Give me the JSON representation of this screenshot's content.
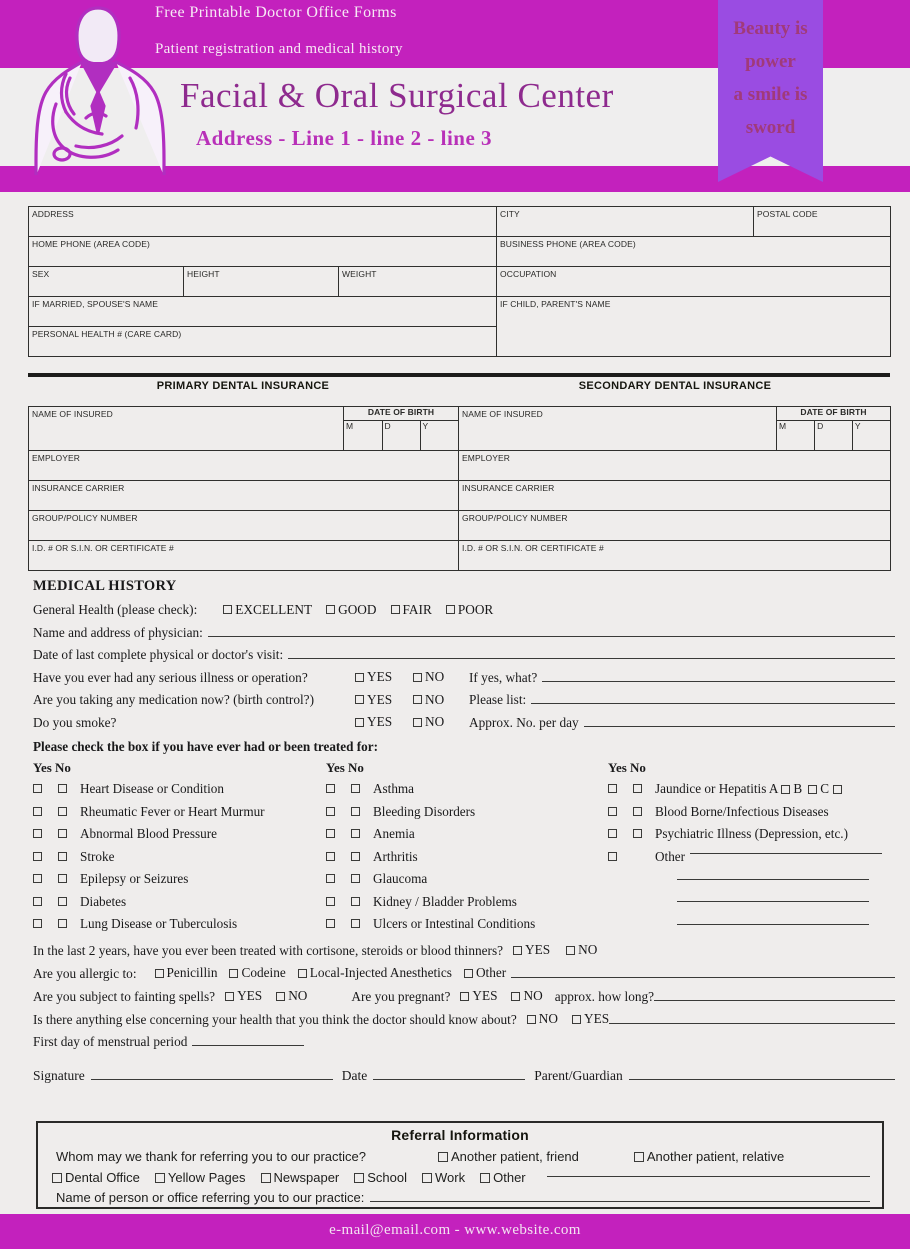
{
  "header": {
    "tagline1": "Free Printable Doctor Office Forms",
    "tagline2": "Patient registration and medical history",
    "clinic_name": "Facial & Oral Surgical Center",
    "address_line": "Address - Line 1 - line 2 - line 3",
    "ribbon_lines": [
      "Beauty is",
      "power",
      "a smile is",
      "sword"
    ],
    "colors": {
      "magenta": "#c321bd",
      "purple": "#9a4ce2",
      "clinic_text": "#8e2a8e",
      "ribbon_text": "#a03a7a"
    }
  },
  "personal": {
    "address": "ADDRESS",
    "city": "CITY",
    "postal_code": "POSTAL CODE",
    "home_phone": "HOME PHONE (AREA CODE)",
    "business_phone": "BUSINESS PHONE (AREA CODE)",
    "sex": "SEX",
    "height": "HEIGHT",
    "weight": "WEIGHT",
    "occupation": "OCCUPATION",
    "spouse": "IF MARRIED, SPOUSE'S NAME",
    "parent": "IF CHILD, PARENT'S NAME",
    "health_number": "PERSONAL HEALTH # (CARE CARD)"
  },
  "insurance": {
    "primary_title": "PRIMARY DENTAL INSURANCE",
    "secondary_title": "SECONDARY DENTAL INSURANCE",
    "name_of_insured": "NAME OF INSURED",
    "date_of_birth": "DATE  OF BIRTH",
    "date_of_birth_2": "DATE OF BIRTH",
    "m": "M",
    "d": "D",
    "y": "Y",
    "employer": "EMPLOYER",
    "carrier": "INSURANCE CARRIER",
    "group_policy": "GROUP/POLICY NUMBER",
    "id_cert": "I.D. # OR S.I.N. OR CERTIFICATE #"
  },
  "medical_history": {
    "title": "MEDICAL HISTORY",
    "general_health_label": "General Health (please check):",
    "general_health_options": [
      "EXCELLENT",
      "GOOD",
      "FAIR",
      "POOR"
    ],
    "physician_label": "Name and address of physician:",
    "last_visit_label": "Date of last complete physical or doctor's visit:",
    "yes": "YES",
    "no": "NO",
    "questions": [
      {
        "q": "Have you ever had any serious illness or operation?",
        "tail": "If yes, what?"
      },
      {
        "q": "Are you taking any medication now? (birth control?)",
        "tail": "Please list:"
      },
      {
        "q": "Do you smoke?",
        "tail": "Approx. No. per day"
      }
    ],
    "check_instruction": "Please check the box if you have ever had or been treated for:",
    "col_head_yes": "Yes",
    "col_head_no": "No",
    "conditions_col1": [
      "Heart Disease or Condition",
      "Rheumatic Fever or Heart Murmur",
      "Abnormal Blood Pressure",
      "Stroke",
      "Epilepsy or Seizures",
      "Diabetes",
      "Lung Disease or Tuberculosis"
    ],
    "conditions_col2": [
      "Asthma",
      "Bleeding Disorders",
      "Anemia",
      "Arthritis",
      "Glaucoma",
      "Kidney / Bladder Problems",
      "Ulcers or Intestinal Conditions"
    ],
    "conditions_col3": [
      "Jaundice or Hepatitis A",
      "Blood Borne/Infectious Diseases",
      "Psychiatric Illness (Depression, etc.)"
    ],
    "hepatitis_b": "B",
    "hepatitis_c": "C",
    "other_label": "Other",
    "cortisone_q": "In the last 2 years, have you ever been treated with cortisone, steroids or blood thinners?",
    "allergic_label": "Are you allergic to:",
    "allergy_options": [
      "Penicillin",
      "Codeine",
      "Local-Injected Anesthetics",
      "Other"
    ],
    "fainting_q": "Are you subject to fainting spells?",
    "pregnant_q": "Are you pregnant?",
    "how_long": "approx. how long?",
    "anything_else_q": "Is there anything else concerning your health that you think the doctor should know about?",
    "menstrual_label": "First day of menstrual period"
  },
  "signature": {
    "signature_label": "Signature",
    "date_label": "Date",
    "parent_label": "Parent/Guardian"
  },
  "referral": {
    "title": "Referral Information",
    "thank_q": "Whom may we thank for referring you to our practice?",
    "opt_friend": "Another patient, friend",
    "opt_relative": "Another patient, relative",
    "sources": [
      "Dental Office",
      "Yellow Pages",
      "Newspaper",
      "School",
      "Work",
      "Other"
    ],
    "name_label": "Name of person or office referring you to our practice:"
  },
  "footer": {
    "contact": "e-mail@email.com - www.website.com"
  }
}
